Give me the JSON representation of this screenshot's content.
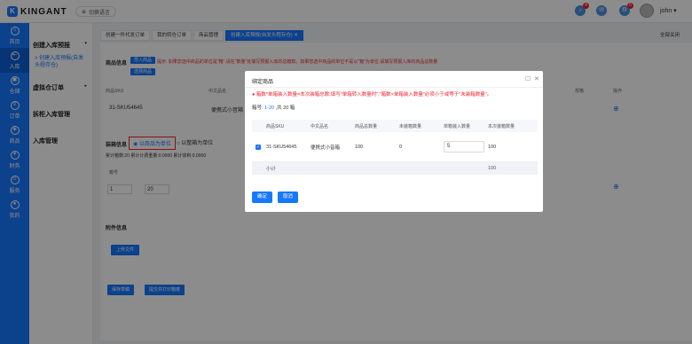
{
  "header": {
    "brand": "KINGANT",
    "language": "切换语言",
    "notifications": [
      {
        "count": "4"
      },
      {
        "count": ""
      },
      {
        "count": "6"
      }
    ],
    "username": "john"
  },
  "sidebar": {
    "items": [
      {
        "label": "首页",
        "icon": "home-icon",
        "glyph": "⌂"
      },
      {
        "label": "入库",
        "icon": "inbound-icon",
        "glyph": "⇤"
      },
      {
        "label": "仓储",
        "icon": "warehouse-icon",
        "glyph": "▣"
      },
      {
        "label": "订单",
        "icon": "order-icon",
        "glyph": "≡"
      },
      {
        "label": "商品",
        "icon": "goods-icon",
        "glyph": "◈"
      },
      {
        "label": "财务",
        "icon": "finance-icon",
        "glyph": "¥"
      },
      {
        "label": "服务",
        "icon": "service-icon",
        "glyph": "☺"
      },
      {
        "label": "我的",
        "icon": "user-icon",
        "glyph": "●"
      }
    ]
  },
  "submenu": {
    "create_inbound": "创建入库预报",
    "create_inbound_sub": "> 创建入库预报(自发头程存仓)",
    "virtual_warehouse": "虚拟仓订单",
    "split_inbound": "拆柜入库管理",
    "inbound_mgmt": "入库管理"
  },
  "tabs": [
    {
      "label": "创建一件代发订单"
    },
    {
      "label": "我的转仓订单"
    },
    {
      "label": "商品管理"
    },
    {
      "label": "创建入库预报(自发头程存仓)",
      "active": true
    }
  ],
  "close_all": "全部关闭",
  "background": {
    "goods_info": "商品信息",
    "import_goods": "导入商品",
    "select_goods": "选择商品",
    "tip": "提示: 如果您选中商品的单位是\"箱\",请在\"数量\"处填写预报入库的总箱数。如果您选中商品的单位不是以\"箱\"为单位,请填写预报入库的商品总数量",
    "packing_info": "装箱信息",
    "by_goods_unit": "以商品为单位",
    "by_box_unit": "以整箱为单位",
    "totals": "累计箱数:20 累计计费重量:0.0000 累计体积:0.0000",
    "attach_info": "附件信息",
    "upload": "上传文件",
    "save_draft": "保存草稿",
    "submit_print": "提交并打印箱唛",
    "box_no": "箱号",
    "range_from": "1",
    "range_to": "20",
    "col_sku": "商品SKU",
    "col_cn": "中文品名",
    "row_sku": "31-SKU54645",
    "row_cn": "便携式小音箱",
    "col_weight": "规格",
    "col_action": "操作"
  },
  "modal": {
    "title": "绑定商品",
    "warning": "箱数*单箱装入数量=本次装箱总数;填写\"单箱转入数量时\",\"箱数×单箱装入数量\"必须小于或等于\"未装箱数量\"。",
    "page_prefix": "箱号: ",
    "page_range": "1-20",
    "page_suffix": " ,共 20 箱",
    "columns": [
      "商品SKU",
      "中文品名",
      "商品总数量",
      "未装箱数量",
      "单箱装入数量",
      "本次装箱数量"
    ],
    "rows": [
      {
        "sku": "31-SKU54645",
        "name": "便携式小音箱",
        "total": "100",
        "unpacked": "0",
        "qty": "5",
        "packed": "100"
      }
    ],
    "subtotal_label": "小计",
    "subtotal_value": "100",
    "confirm": "确定",
    "cancel": "取消"
  }
}
